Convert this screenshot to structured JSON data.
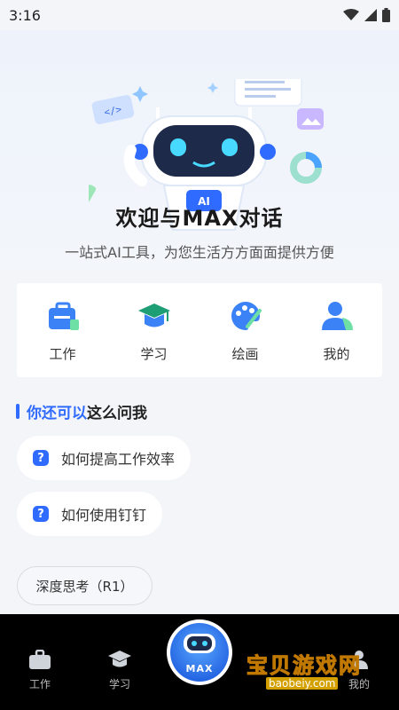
{
  "status": {
    "time": "3:16"
  },
  "hero": {
    "title": "欢迎与MAX对话",
    "subtitle": "一站式AI工具，为您生活方方面面提供方便",
    "badge": "AI"
  },
  "tools": [
    {
      "label": "工作",
      "icon": "briefcase-icon"
    },
    {
      "label": "学习",
      "icon": "graduation-cap-icon"
    },
    {
      "label": "绘画",
      "icon": "palette-icon"
    },
    {
      "label": "我的",
      "icon": "user-icon"
    }
  ],
  "section": {
    "highlight": "你还可以",
    "rest": "这么问我"
  },
  "suggestions": [
    "如何提高工作效率",
    "如何使用钉钉"
  ],
  "deep_think": "深度思考（R1）",
  "nav": {
    "items": [
      {
        "label": "工作",
        "icon": "briefcase-icon"
      },
      {
        "label": "学习",
        "icon": "graduation-cap-icon"
      },
      {
        "label": "我的",
        "icon": "user-icon"
      }
    ],
    "center": "MAX"
  },
  "watermark": {
    "text": "宝贝游戏网",
    "url": "baobeiy.com"
  },
  "colors": {
    "accent": "#2f6bff",
    "background": "#f3f5f9",
    "nav": "#000000"
  }
}
